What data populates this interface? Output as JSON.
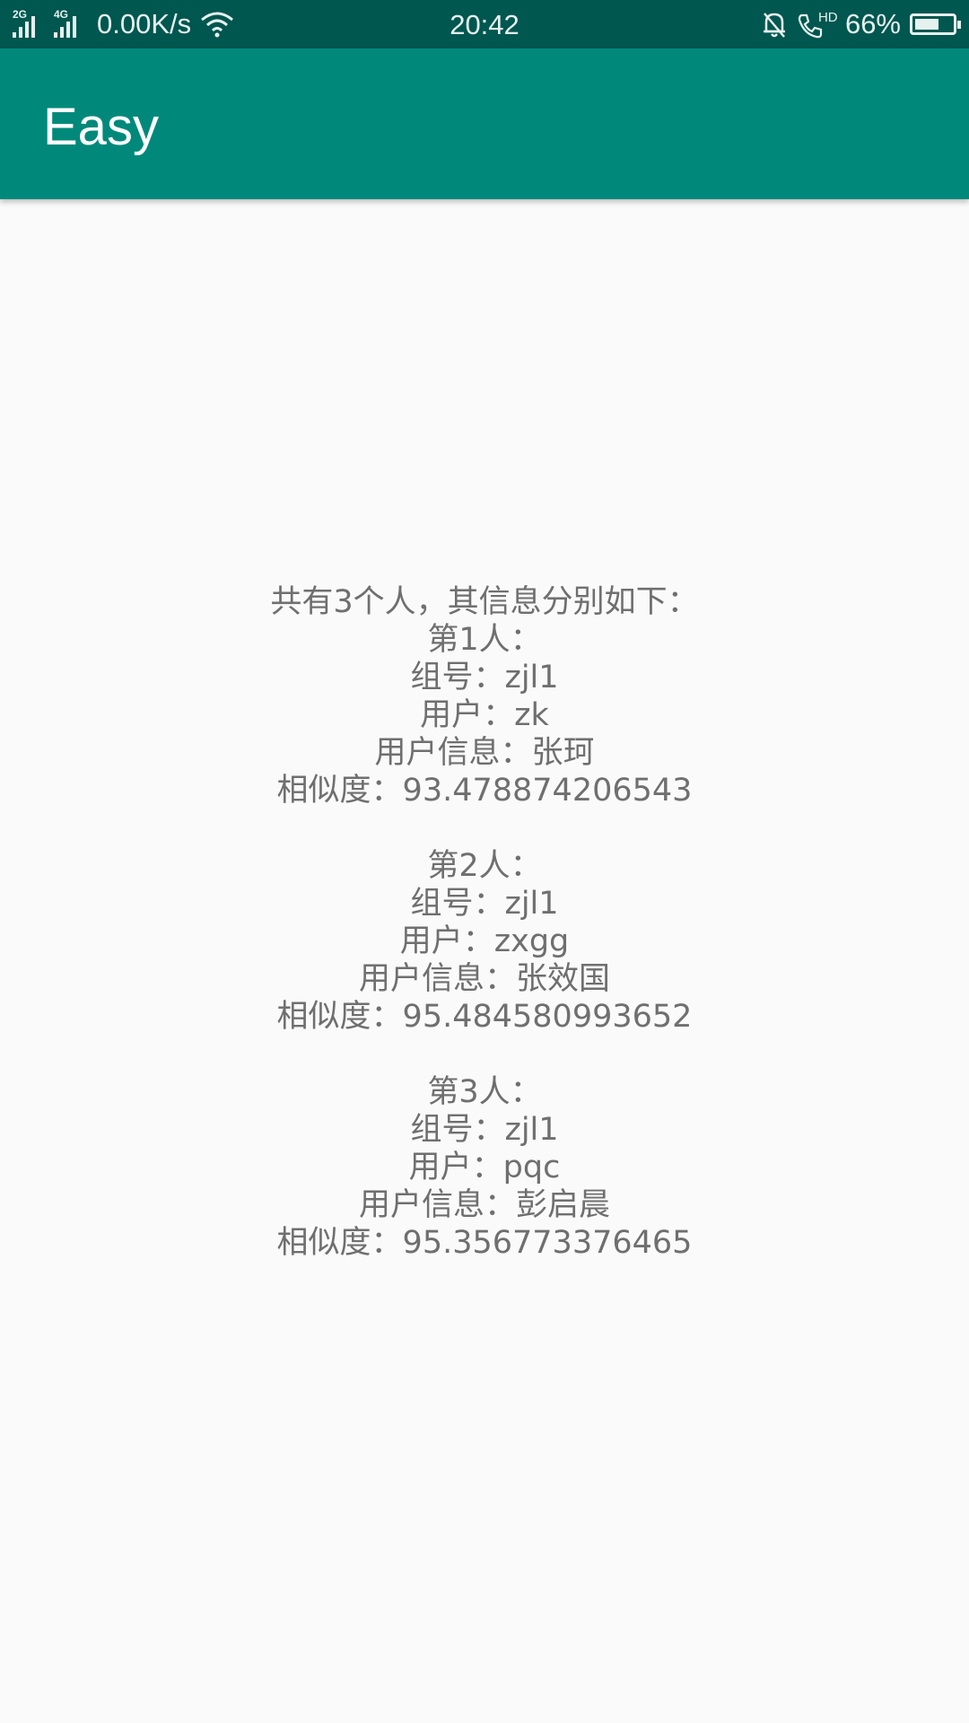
{
  "status_bar": {
    "sim1_tag": "2G",
    "sim2_tag": "4G",
    "net_speed": "0.00K/s",
    "time": "20:42",
    "hd_tag": "HD",
    "battery_pct": "66%",
    "battery_level": 0.66,
    "icons": [
      "signal-icon",
      "signal-icon",
      "wifi-icon",
      "bell-off-icon",
      "phone-hd-icon",
      "battery-icon"
    ]
  },
  "app_bar": {
    "title": "Easy",
    "color": "#00897b",
    "status_color": "#00574f"
  },
  "result": {
    "summary": "共有3个人，其信息分别如下：",
    "people": [
      {
        "heading": "第1人：",
        "group": "组号：zjl1",
        "user": "用户：zk",
        "user_info": "用户信息：张珂",
        "similarity": "相似度：93.478874206543"
      },
      {
        "heading": "第2人：",
        "group": "组号：zjl1",
        "user": "用户：zxgg",
        "user_info": "用户信息：张效国",
        "similarity": "相似度：95.484580993652"
      },
      {
        "heading": "第3人：",
        "group": "组号：zjl1",
        "user": "用户：pqc",
        "user_info": "用户信息：彭启晨",
        "similarity": "相似度：95.356773376465"
      }
    ]
  }
}
